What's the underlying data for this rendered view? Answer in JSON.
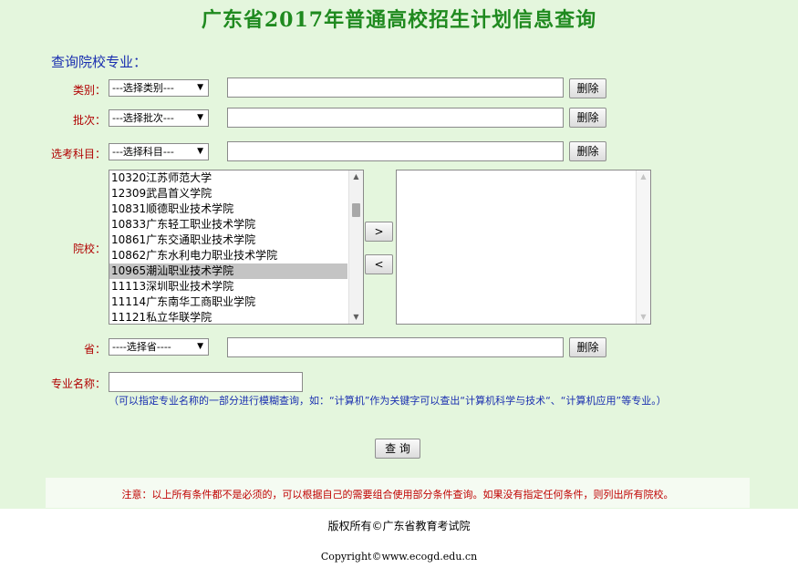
{
  "header": {
    "title": "广东省2017年普通高校招生计划信息查询"
  },
  "form": {
    "section_title": "查询院校专业：",
    "category": {
      "label": "类别：",
      "selected": "---选择类别---",
      "delete_label": "删除"
    },
    "batch": {
      "label": "批次：",
      "selected": "---选择批次---",
      "delete_label": "删除"
    },
    "subject": {
      "label": "选考科目：",
      "selected": "---选择科目---",
      "delete_label": "删除"
    },
    "school": {
      "label": "院校：",
      "options": [
        "10320江苏师范大学",
        "12309武昌首义学院",
        "10831顺德职业技术学院",
        "10833广东轻工职业技术学院",
        "10861广东交通职业技术学院",
        "10862广东水利电力职业技术学院",
        "10965潮汕职业技术学院",
        "11113深圳职业技术学院",
        "11114广东南华工商职业学院",
        "11121私立华联学院"
      ],
      "selected_option": "10965潮汕职业技术学院",
      "add_label": ">",
      "remove_label": "<"
    },
    "province": {
      "label": "省：",
      "selected": "----选择省----",
      "delete_label": "删除"
    },
    "major": {
      "label": "专业名称：",
      "value": "",
      "hint": "（可以指定专业名称的一部分进行模糊查询，如：“计算机”作为关键字可以查出“计算机科学与技术“、“计算机应用”等专业。）"
    },
    "query_label": "查 询"
  },
  "note": "注意：以上所有条件都不是必须的，可以根据自己的需要组合使用部分条件查询。如果没有指定任何条件，则列出所有院校。",
  "footer": {
    "copyright_cn": "版权所有©广东省教育考试院",
    "copyright_en": "Copyright©www.ecogd.edu.cn"
  },
  "colors": {
    "background": "#e4f6dd",
    "title": "#1f8a1f",
    "label": "#b00000",
    "hint": "#1a2fb0",
    "note": "#c00000"
  }
}
